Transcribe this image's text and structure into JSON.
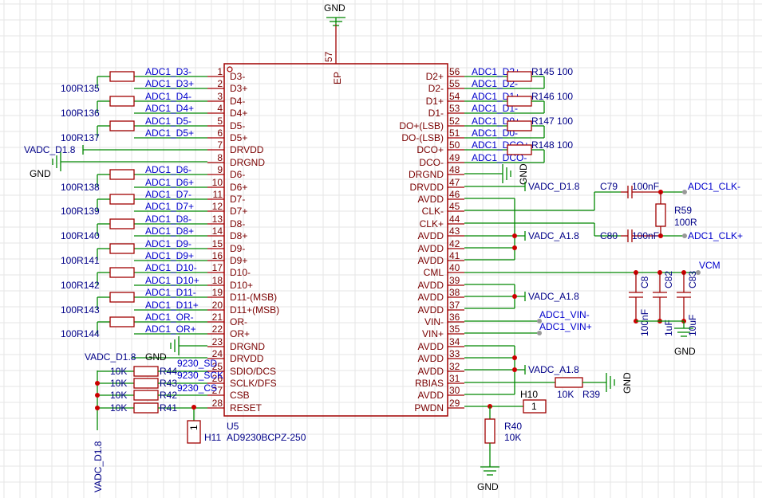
{
  "chip": {
    "ref": "U5",
    "value": "AD9230BCPZ-250",
    "ep_num": "57",
    "ep_name": "EP",
    "left_pins": [
      {
        "num": "1",
        "name": "D3-"
      },
      {
        "num": "2",
        "name": "D3+"
      },
      {
        "num": "3",
        "name": "D4-"
      },
      {
        "num": "4",
        "name": "D4+"
      },
      {
        "num": "5",
        "name": "D5-"
      },
      {
        "num": "6",
        "name": "D5+"
      },
      {
        "num": "7",
        "name": "DRVDD"
      },
      {
        "num": "8",
        "name": "DRGND"
      },
      {
        "num": "9",
        "name": "D6-"
      },
      {
        "num": "10",
        "name": "D6+"
      },
      {
        "num": "11",
        "name": "D7-"
      },
      {
        "num": "12",
        "name": "D7+"
      },
      {
        "num": "13",
        "name": "D8-"
      },
      {
        "num": "14",
        "name": "D8+"
      },
      {
        "num": "15",
        "name": "D9-"
      },
      {
        "num": "16",
        "name": "D9+"
      },
      {
        "num": "17",
        "name": "D10-"
      },
      {
        "num": "18",
        "name": "D10+"
      },
      {
        "num": "19",
        "name": "D11-(MSB)"
      },
      {
        "num": "20",
        "name": "D11+(MSB)"
      },
      {
        "num": "21",
        "name": "OR-"
      },
      {
        "num": "22",
        "name": "OR+"
      },
      {
        "num": "23",
        "name": "DRGND"
      },
      {
        "num": "24",
        "name": "DRVDD"
      },
      {
        "num": "25",
        "name": "SDIO/DCS"
      },
      {
        "num": "26",
        "name": "SCLK/DFS"
      },
      {
        "num": "27",
        "name": "CSB"
      },
      {
        "num": "28",
        "name": "RESET"
      }
    ],
    "right_pins": [
      {
        "num": "56",
        "name": "D2+"
      },
      {
        "num": "55",
        "name": "D2-"
      },
      {
        "num": "54",
        "name": "D1+"
      },
      {
        "num": "53",
        "name": "D1-"
      },
      {
        "num": "52",
        "name": "DO+(LSB)"
      },
      {
        "num": "51",
        "name": "DO-(LSB)"
      },
      {
        "num": "50",
        "name": "DCO+"
      },
      {
        "num": "49",
        "name": "DCO-"
      },
      {
        "num": "48",
        "name": "DRGND"
      },
      {
        "num": "47",
        "name": "DRVDD"
      },
      {
        "num": "46",
        "name": "AVDD"
      },
      {
        "num": "45",
        "name": "CLK-"
      },
      {
        "num": "44",
        "name": "CLK+"
      },
      {
        "num": "43",
        "name": "AVDD"
      },
      {
        "num": "42",
        "name": "AVDD"
      },
      {
        "num": "41",
        "name": "AVDD"
      },
      {
        "num": "40",
        "name": "CML"
      },
      {
        "num": "39",
        "name": "AVDD"
      },
      {
        "num": "38",
        "name": "AVDD"
      },
      {
        "num": "37",
        "name": "AVDD"
      },
      {
        "num": "36",
        "name": "VIN-"
      },
      {
        "num": "35",
        "name": "VIN+"
      },
      {
        "num": "34",
        "name": "AVDD"
      },
      {
        "num": "33",
        "name": "AVDD"
      },
      {
        "num": "32",
        "name": "AVDD"
      },
      {
        "num": "31",
        "name": "RBIAS"
      },
      {
        "num": "30",
        "name": "AVDD"
      },
      {
        "num": "29",
        "name": "PWDN"
      }
    ]
  },
  "left_nets": [
    {
      "row": 0,
      "label": "ADC1_D3-"
    },
    {
      "row": 1,
      "label": "ADC1_D3+"
    },
    {
      "row": 2,
      "label": "ADC1_D4-"
    },
    {
      "row": 3,
      "label": "ADC1_D4+"
    },
    {
      "row": 4,
      "label": "ADC1_D5-"
    },
    {
      "row": 5,
      "label": "ADC1_D5+"
    },
    {
      "row": 8,
      "label": "ADC1_D6-"
    },
    {
      "row": 9,
      "label": "ADC1_D6+"
    },
    {
      "row": 10,
      "label": "ADC1_D7-"
    },
    {
      "row": 11,
      "label": "ADC1_D7+"
    },
    {
      "row": 12,
      "label": "ADC1_D8-"
    },
    {
      "row": 13,
      "label": "ADC1_D8+"
    },
    {
      "row": 14,
      "label": "ADC1_D9-"
    },
    {
      "row": 15,
      "label": "ADC1_D9+"
    },
    {
      "row": 16,
      "label": "ADC1_D10-"
    },
    {
      "row": 17,
      "label": "ADC1_D10+"
    },
    {
      "row": 18,
      "label": "ADC1_D11-"
    },
    {
      "row": 19,
      "label": "ADC1_D11+"
    },
    {
      "row": 20,
      "label": "ADC1_OR-"
    },
    {
      "row": 21,
      "label": "ADC1_OR+"
    }
  ],
  "left_res": [
    {
      "row": 1,
      "text": "100R135"
    },
    {
      "row": 3,
      "text": "100R136"
    },
    {
      "row": 5,
      "text": "100R137"
    },
    {
      "row": 9,
      "text": "100R138"
    },
    {
      "row": 11,
      "text": "100R139"
    },
    {
      "row": 13,
      "text": "100R140"
    },
    {
      "row": 15,
      "text": "100R141"
    },
    {
      "row": 17,
      "text": "100R142"
    },
    {
      "row": 19,
      "text": "100R143"
    },
    {
      "row": 21,
      "text": "100R144"
    }
  ],
  "right_nets": [
    {
      "row": 0,
      "label": "ADC1_D2+"
    },
    {
      "row": 1,
      "label": "ADC1_D2-"
    },
    {
      "row": 2,
      "label": "ADC1_D1+"
    },
    {
      "row": 3,
      "label": "ADC1_D1-"
    },
    {
      "row": 4,
      "label": "ADC1_D0+"
    },
    {
      "row": 5,
      "label": "ADC1_D0-"
    },
    {
      "row": 6,
      "label": "ADC1_DCO+"
    },
    {
      "row": 7,
      "label": "ADC1_DCO-"
    }
  ],
  "right_res": [
    {
      "row": 0,
      "text": "R145 100"
    },
    {
      "row": 2,
      "text": "R146 100"
    },
    {
      "row": 4,
      "text": "R147 100"
    },
    {
      "row": 6,
      "text": "R148 100"
    }
  ],
  "labels": {
    "gnd": "GND",
    "vadc_d18": "VADC_D1.8",
    "vadc_a18": "VADC_A1.8",
    "vcm": "VCM",
    "clk_minus": "ADC1_CLK-",
    "clk_plus": "ADC1_CLK+",
    "vin_minus": "ADC1_VIN-",
    "vin_plus": "ADC1_VIN+",
    "c79": "C79",
    "c79_val": "100nF",
    "c80": "C80",
    "c80_val": "100nF",
    "r59": "R59",
    "r59_val": "100R",
    "c8": "C8",
    "c8_val": "100nF",
    "c82": "C82",
    "c82_val": "1uF",
    "c83": "C83",
    "c83_val": "10uF",
    "r39": "R39",
    "r39_val": "10K",
    "h10": "H10",
    "h10_pin": "1",
    "r40": "R40",
    "r40_val": "10K",
    "h11": "H11",
    "h11_pin": "1",
    "r44": "R44",
    "r43": "R43",
    "r42": "R42",
    "r41": "R41",
    "k10": "10K",
    "sdio_net": "9230_SD",
    "sclk_net": "9230_SCK",
    "csb_net": "9230_CS"
  }
}
